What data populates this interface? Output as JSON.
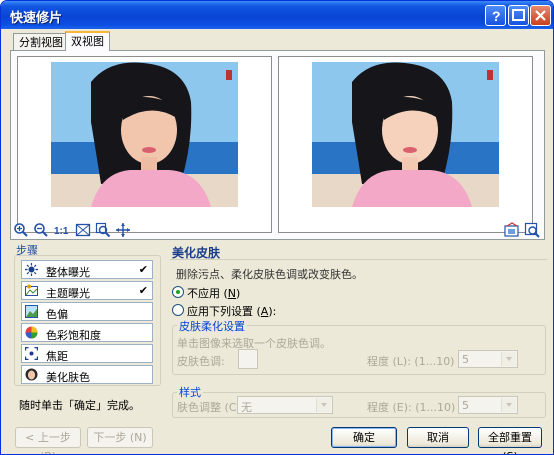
{
  "window": {
    "title": "快速修片"
  },
  "tabs": [
    {
      "label": "分割视图"
    },
    {
      "label": "双视图"
    }
  ],
  "steps": {
    "heading": "步骤",
    "items": [
      {
        "label": "整体曝光",
        "checked": true,
        "icon": "exposure-icon"
      },
      {
        "label": "主题曝光",
        "checked": true,
        "icon": "subject-exposure-icon"
      },
      {
        "label": "色偏",
        "checked": false,
        "icon": "color-cast-icon"
      },
      {
        "label": "色彩饱和度",
        "checked": false,
        "icon": "saturation-icon"
      },
      {
        "label": "焦距",
        "checked": false,
        "icon": "focus-icon"
      },
      {
        "label": "美化肤色",
        "checked": false,
        "icon": "skin-tone-icon"
      }
    ],
    "check_mark": "✔",
    "hint": "随时单击「确定」完成。"
  },
  "section": {
    "title": "美化皮肤",
    "description": "删除污点、柔化皮肤色调或改变肤色。",
    "radio_none": "不应用 (",
    "radio_none_key": "N",
    "radio_none_end": ")",
    "radio_apply": "应用下列设置 (",
    "radio_apply_key": "A",
    "radio_apply_end": "):"
  },
  "soften_group": {
    "title": "皮肤柔化设置",
    "instruction": "单击图像来选取一个皮肤色调。",
    "skin_tone_label": "皮肤色调:",
    "degree_label": "程度 (L): (1...10)",
    "degree_value": "5"
  },
  "style_group": {
    "title": "样式",
    "skin_adjust_label": "肤色调整 (C):",
    "skin_adjust_value": "无",
    "degree_label": "程度 (E): (1...10)",
    "degree_value": "5"
  },
  "buttons": {
    "prev": "< 上一步 (B)",
    "next": "下一步 (N) >",
    "ok": "确定",
    "cancel": "取消",
    "reset_all": "全部重置 (S)"
  },
  "colors": {
    "titlebar": "#0a45d4",
    "dialog_bg": "#ece9d8",
    "accent_text": "#1a3e8c"
  }
}
